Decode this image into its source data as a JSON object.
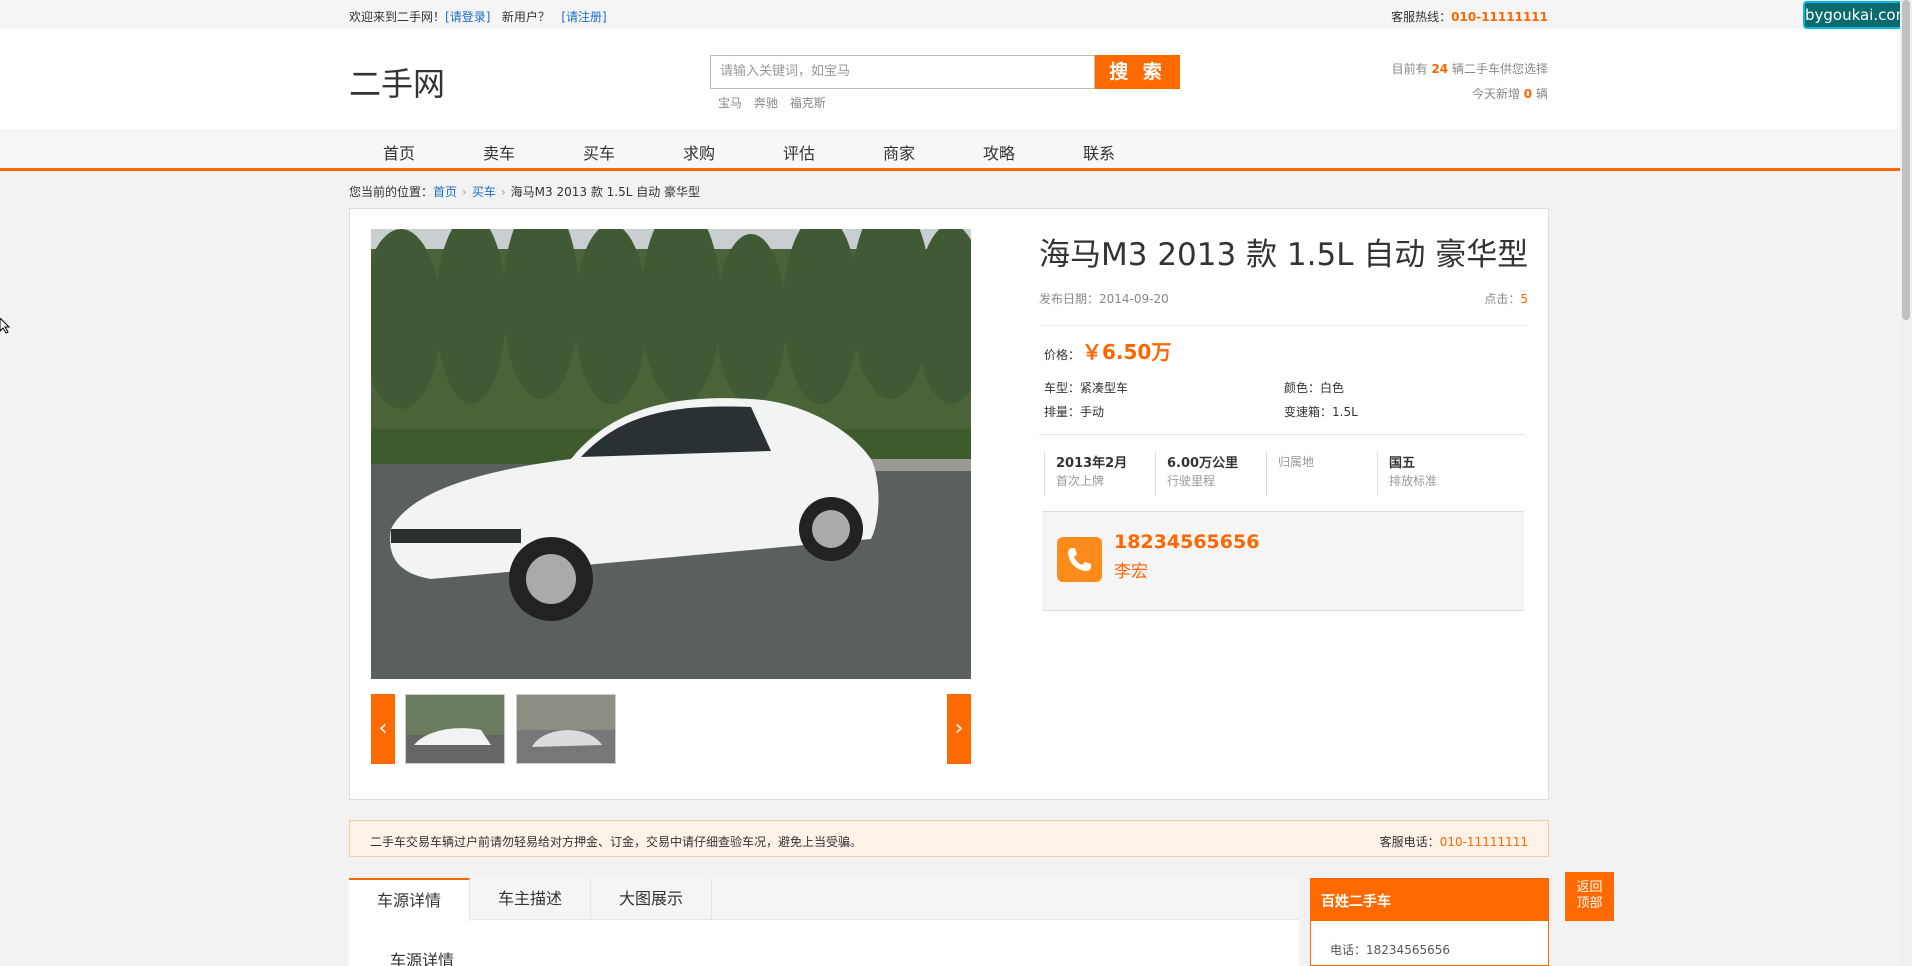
{
  "topbar": {
    "welcome": "欢迎来到二手网！",
    "login": "[请登录]",
    "new_user": "新用户？",
    "register": "[请注册]",
    "hotline_label": "客服热线：",
    "hotline": "010-11111111"
  },
  "watermark": "bygoukai.com",
  "header": {
    "logo": "二手网",
    "search_placeholder": "请输入关键词，如宝马",
    "search_button": "搜 索",
    "hotwords": [
      "宝马",
      "奔驰",
      "福克斯"
    ],
    "stats_prefix": "目前有",
    "stats_count": "24",
    "stats_suffix": "辆二手车供您选择",
    "today_prefix": "今天新增",
    "today_count": "0",
    "today_suffix": "辆"
  },
  "nav": [
    "首页",
    "卖车",
    "买车",
    "求购",
    "评估",
    "商家",
    "攻略",
    "联系"
  ],
  "breadcrumb": {
    "label": "您当前的位置：",
    "home": "首页",
    "buy": "买车",
    "current": "海马M3 2013 款 1.5L 自动 豪华型"
  },
  "car": {
    "title": "海马M3 2013 款 1.5L 自动 豪华型",
    "pubdate_label": "发布日期：",
    "pubdate": "2014-09-20",
    "clicks_label": "点击：",
    "clicks": "5",
    "price_label": "价格：",
    "price": "￥6.50万",
    "specs": {
      "type_label": "车型：",
      "type": "紧凑型车",
      "color_label": "颜色：",
      "color": "白色",
      "displacement_label": "排量：",
      "displacement": "手动",
      "gearbox_label": "变速箱：",
      "gearbox": "1.5L"
    },
    "key_values": [
      {
        "value": "2013年2月",
        "label": "首次上牌"
      },
      {
        "value": "6.00万公里",
        "label": "行驶里程"
      },
      {
        "value": "",
        "label": "归属地"
      },
      {
        "value": "国五",
        "label": "排放标准"
      }
    ],
    "phone": "18234565656",
    "owner": "李宏"
  },
  "notice": {
    "text": "二手车交易车辆过户前请勿轻易给对方押金、订金，交易中请仔细查验车况，避免上当受骗。",
    "service_label": "客服电话：",
    "service_phone": "010-11111111"
  },
  "tabs": [
    "车源详情",
    "车主描述",
    "大图展示"
  ],
  "section_title": "车源详情",
  "side": {
    "title": "百姓二手车",
    "phone_label": "电话：",
    "phone": "18234565656"
  },
  "backtop": {
    "line1": "返回",
    "line2": "顶部"
  },
  "icons": {
    "prev": "chevron-left-icon",
    "next": "chevron-right-icon",
    "phone": "phone-icon"
  },
  "colors": {
    "accent": "#ff6600",
    "link": "#1a6ec7"
  }
}
